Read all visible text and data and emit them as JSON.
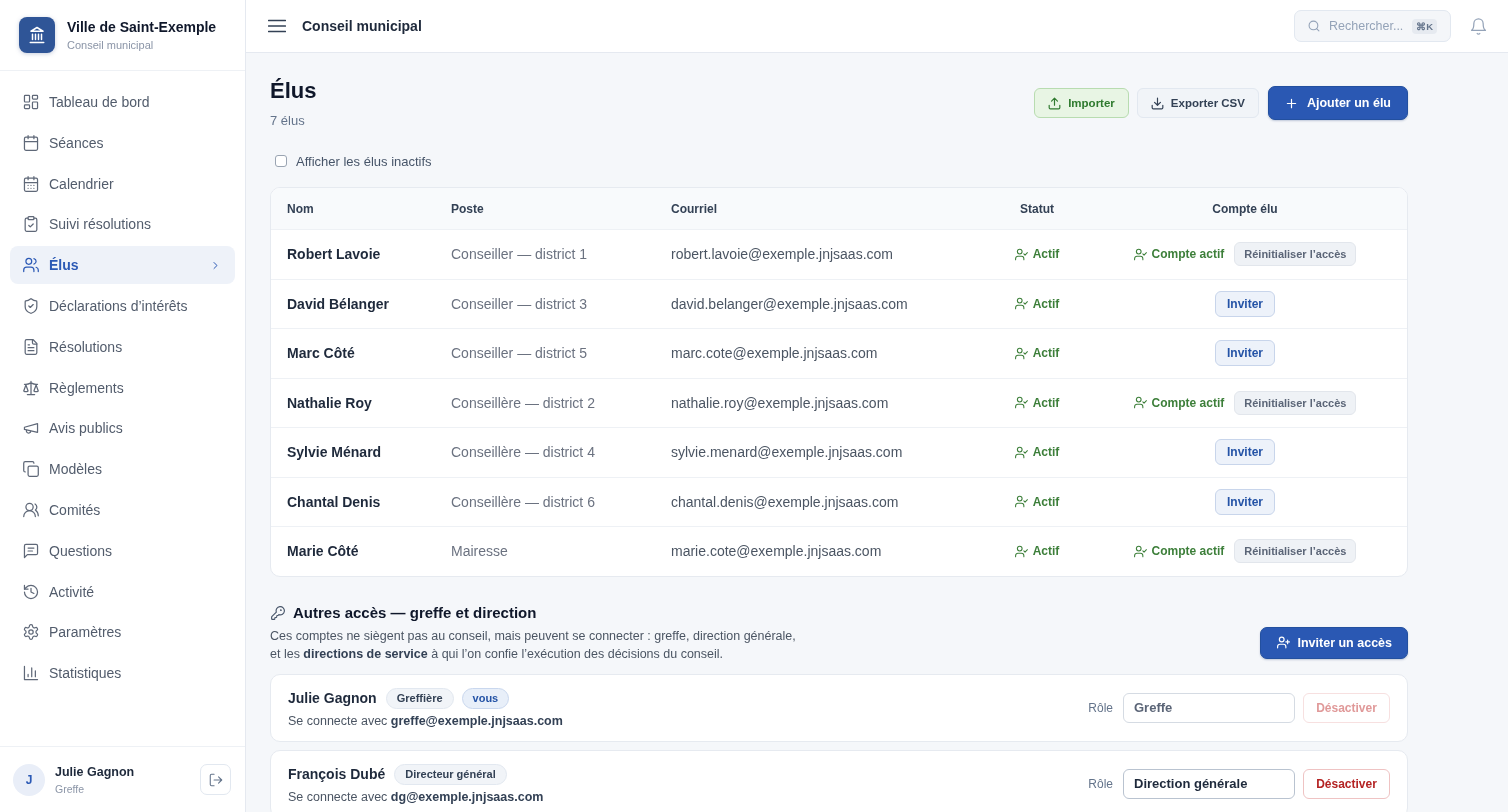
{
  "app": {
    "name": "Ville de Saint-Exemple",
    "subtitle": "Conseil municipal"
  },
  "sidebar": {
    "items": [
      {
        "label": "Tableau de bord",
        "selected": false
      },
      {
        "label": "Séances",
        "selected": false
      },
      {
        "label": "Calendrier",
        "selected": false
      },
      {
        "label": "Suivi résolutions",
        "selected": false
      },
      {
        "label": "Élus",
        "selected": true
      },
      {
        "label": "Déclarations d’intérêts",
        "selected": false
      },
      {
        "label": "Résolutions",
        "selected": false
      },
      {
        "label": "Règlements",
        "selected": false
      },
      {
        "label": "Avis publics",
        "selected": false
      },
      {
        "label": "Modèles",
        "selected": false
      },
      {
        "label": "Comités",
        "selected": false
      },
      {
        "label": "Questions",
        "selected": false
      },
      {
        "label": "Activité",
        "selected": false
      },
      {
        "label": "Paramètres",
        "selected": false
      },
      {
        "label": "Statistiques",
        "selected": false
      }
    ],
    "user": {
      "initial": "J",
      "name": "Julie Gagnon",
      "role": "Greffe"
    }
  },
  "header": {
    "title": "Conseil municipal",
    "search": {
      "placeholder": "Rechercher...",
      "shortcut": "⌘K"
    }
  },
  "page": {
    "title": "Élus",
    "count": "7 élus",
    "actions": [
      {
        "kind": "import",
        "label": "Importer"
      },
      {
        "kind": "export",
        "label": "Exporter CSV"
      },
      {
        "kind": "add",
        "label": "Ajouter un élu"
      }
    ],
    "show_inactive": {
      "label": "Afficher les élus inactifs",
      "checked": false
    }
  },
  "table": {
    "columns": [
      "Nom",
      "Poste",
      "Courriel",
      "Statut",
      "Compte élu"
    ],
    "rows": [
      {
        "name": "Robert Lavoie",
        "position": "Conseiller — district 1",
        "email": "robert.lavoie@exemple.jnjsaas.com",
        "status": "Actif",
        "account": {
          "kind": "active",
          "label": "Compte actif",
          "action": "Réinitialiser l’accès"
        }
      },
      {
        "name": "David Bélanger",
        "position": "Conseiller — district 3",
        "email": "david.belanger@exemple.jnjsaas.com",
        "status": "Actif",
        "account": {
          "kind": "invite",
          "action": "Inviter"
        }
      },
      {
        "name": "Marc Côté",
        "position": "Conseiller — district 5",
        "email": "marc.cote@exemple.jnjsaas.com",
        "status": "Actif",
        "account": {
          "kind": "invite",
          "action": "Inviter"
        }
      },
      {
        "name": "Nathalie Roy",
        "position": "Conseillère — district 2",
        "email": "nathalie.roy@exemple.jnjsaas.com",
        "status": "Actif",
        "account": {
          "kind": "active",
          "label": "Compte actif",
          "action": "Réinitialiser l’accès"
        }
      },
      {
        "name": "Sylvie Ménard",
        "position": "Conseillère — district 4",
        "email": "sylvie.menard@exemple.jnjsaas.com",
        "status": "Actif",
        "account": {
          "kind": "invite",
          "action": "Inviter"
        }
      },
      {
        "name": "Chantal Denis",
        "position": "Conseillère — district 6",
        "email": "chantal.denis@exemple.jnjsaas.com",
        "status": "Actif",
        "account": {
          "kind": "invite",
          "action": "Inviter"
        }
      },
      {
        "name": "Marie Côté",
        "position": "Mairesse",
        "email": "marie.cote@exemple.jnjsaas.com",
        "status": "Actif",
        "account": {
          "kind": "active",
          "label": "Compte actif",
          "action": "Réinitialiser l’accès"
        }
      }
    ]
  },
  "other_access": {
    "title": "Autres accès — greffe et direction",
    "description": "Ces comptes ne siègent pas au conseil, mais peuvent se connecter : greffe, direction générale, et les **directions de service** à qui l’on confie l’exécution des décisions du conseil.",
    "invite_button": "Inviter un accès",
    "accounts": [
      {
        "name": "Julie Gagnon",
        "badges": [
          {
            "kind": "role",
            "label": "Greffière"
          },
          {
            "kind": "self",
            "label": "vous"
          }
        ],
        "login": "Se connecte avec **greffe@exemple.jnjsaas.com**",
        "role_label": "Rôle",
        "role_field": {
          "value": "Greffe",
          "disabled": true
        },
        "deactivate": {
          "label": "Désactiver",
          "disabled": true
        }
      },
      {
        "name": "François Dubé",
        "badges": [
          {
            "kind": "role",
            "label": "Directeur général"
          }
        ],
        "login": "Se connecte avec **dg@exemple.jnjsaas.com**",
        "role_label": "Rôle",
        "role_field": {
          "value": "Direction générale",
          "disabled": false
        },
        "deactivate": {
          "label": "Désactiver",
          "disabled": false
        }
      }
    ]
  }
}
